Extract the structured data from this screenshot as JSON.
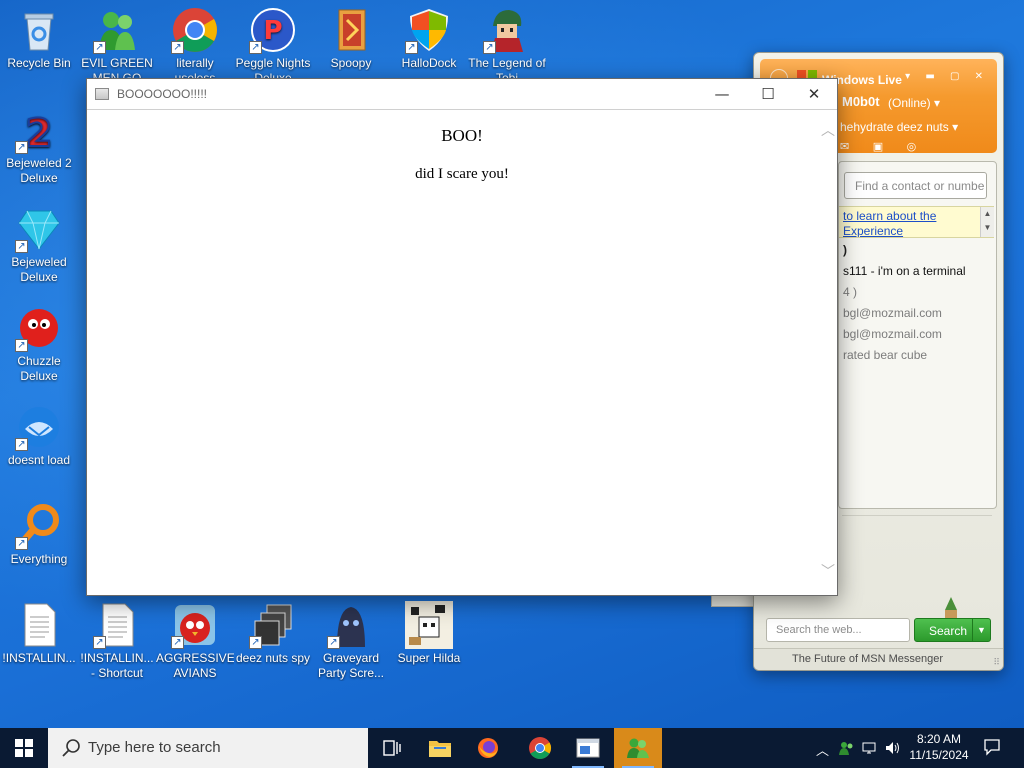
{
  "desktop": {
    "icons": [
      {
        "label": "Recycle Bin"
      },
      {
        "label": "EVIL GREEN MEN GO"
      },
      {
        "label": "literally useless"
      },
      {
        "label": "Peggle Nights Deluxe"
      },
      {
        "label": "Spoopy"
      },
      {
        "label": "HalloDock"
      },
      {
        "label": "The Legend of Tobi"
      },
      {
        "label": "Bejeweled 2 Deluxe"
      },
      {
        "label": "Bejeweled Deluxe"
      },
      {
        "label": "Chuzzle Deluxe"
      },
      {
        "label": "doesnt load"
      },
      {
        "label": "Everything"
      },
      {
        "label": "!INSTALLIN..."
      },
      {
        "label": "!INSTALLIN... - Shortcut"
      },
      {
        "label": "AGGRESSIVE AVIANS"
      },
      {
        "label": "deez nuts spy"
      },
      {
        "label": "Graveyard Party Scre..."
      },
      {
        "label": "Super Hilda"
      }
    ]
  },
  "popup": {
    "title": "BOOOOOOO!!!!!",
    "heading": "BOO!",
    "message": "did I scare you!"
  },
  "msn": {
    "brand": "Windows Live",
    "username": "M0b0t",
    "status": "(Online) ▾",
    "personal_message": "hehydrate deez nuts ▾",
    "search_placeholder": "Find a contact or numbe",
    "banner_line1": "to learn about the",
    "banner_line2": "Experience",
    "contacts": [
      {
        "text": ")",
        "kind": "group"
      },
      {
        "text": "s111 - i'm on a terminal",
        "kind": "on"
      },
      {
        "text": "4 )",
        "kind": "off"
      },
      {
        "text": "bgl@mozmail.com",
        "kind": "off"
      },
      {
        "text": "bgl@mozmail.com",
        "kind": "off"
      },
      {
        "text": "rated bear cube",
        "kind": "off"
      }
    ],
    "web_search_placeholder": "Search the web...",
    "search_button": "Search",
    "footer": "The Future of MSN Messenger"
  },
  "taskbar": {
    "search_placeholder": "Type here to search",
    "time": "8:20 AM",
    "date": "11/15/2024",
    "accent": "#d98a1a"
  }
}
